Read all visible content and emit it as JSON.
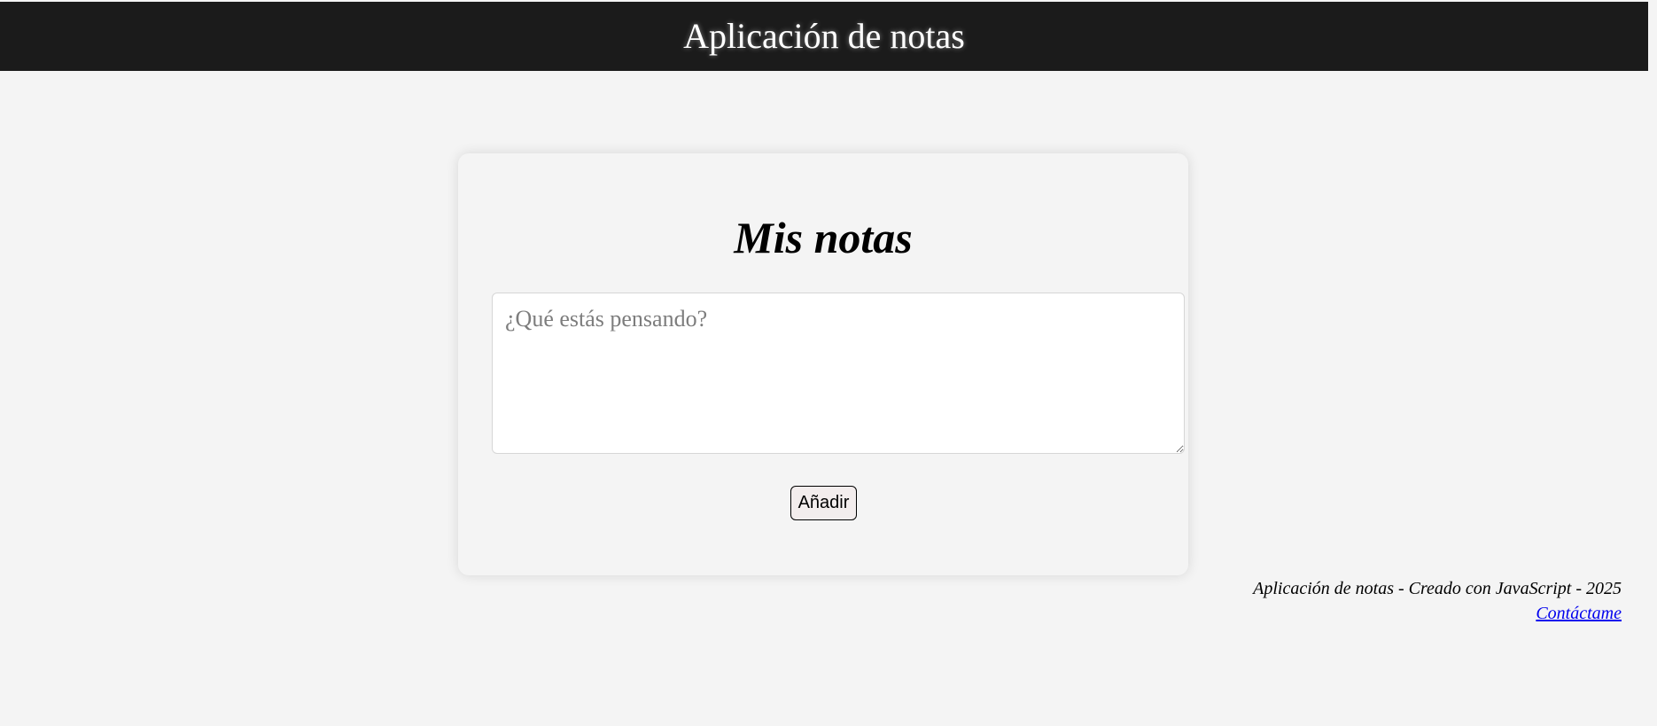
{
  "header": {
    "title": "Aplicación de notas"
  },
  "card": {
    "title": "Mis notas",
    "input": {
      "value": "",
      "placeholder": "¿Qué estás pensando?"
    },
    "add_button_label": "Añadir"
  },
  "footer": {
    "text": "Aplicación de notas - Creado con JavaScript - 2025",
    "contact_link": "Contáctame"
  },
  "colors": {
    "header_background": "#1b1b1b",
    "page_background": "#f4f4f4",
    "link": "#0000ee"
  }
}
